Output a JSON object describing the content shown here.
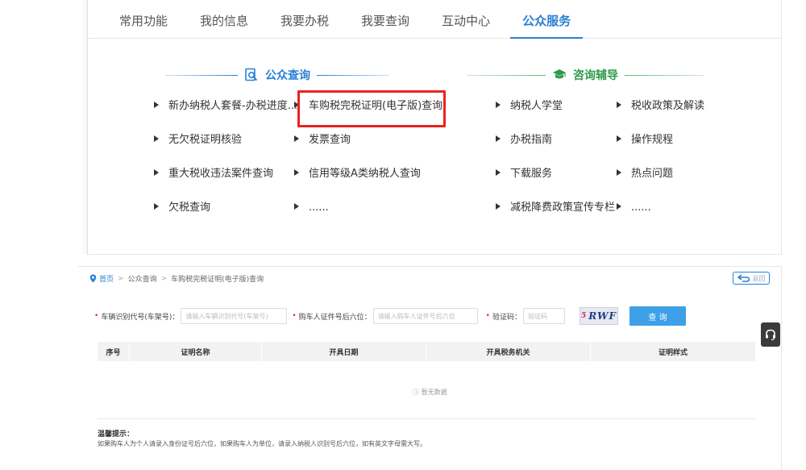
{
  "tabs": [
    {
      "label": "常用功能",
      "active": false
    },
    {
      "label": "我的信息",
      "active": false
    },
    {
      "label": "我要办税",
      "active": false
    },
    {
      "label": "我要查询",
      "active": false
    },
    {
      "label": "互动中心",
      "active": false
    },
    {
      "label": "公众服务",
      "active": true
    }
  ],
  "public_query": {
    "title": "公众查询",
    "links": [
      "新办纳税人套餐-办税进度...",
      "车购税完税证明(电子版)查询",
      "无欠税证明核验",
      "发票查询",
      "重大税收违法案件查询",
      "信用等级A类纳税人查询",
      "欠税查询",
      "......"
    ]
  },
  "consult": {
    "title": "咨询辅导",
    "links": [
      "纳税人学堂",
      "税收政策及解读",
      "办税指南",
      "操作规程",
      "下载服务",
      "热点问题",
      "减税降费政策宣传专栏",
      "......"
    ]
  },
  "breadcrumb": {
    "home": "首页",
    "level1": "公众查询",
    "level2": "车购税完税证明(电子版)查询"
  },
  "back_label": "返回",
  "form": {
    "vin_label": "车辆识别代号(车架号)：",
    "vin_placeholder": "请输入车辆识别代号(车架号)",
    "id_label": "购车人证件号后六位：",
    "id_placeholder": "请输入购车人证件号后六位",
    "captcha_label": "验证码：",
    "captcha_placeholder": "验证码",
    "captcha_text_a": "5",
    "captcha_text_b": "RWF",
    "query_label": "查 询"
  },
  "table": {
    "headers": [
      "序号",
      "证明名称",
      "开具日期",
      "开具税务机关",
      "证明样式"
    ],
    "empty_text": "暂无数据"
  },
  "tip": {
    "title": "温馨提示：",
    "body": "如果购车人为个人请录入身份证号后六位，如果购车人为单位，请录入纳税人识别号后六位，如有英文字母需大写。"
  },
  "colors": {
    "accent": "#2a7fd4",
    "highlight": "#e8231f",
    "green": "#2e9a48",
    "button": "#3ea0e8"
  }
}
